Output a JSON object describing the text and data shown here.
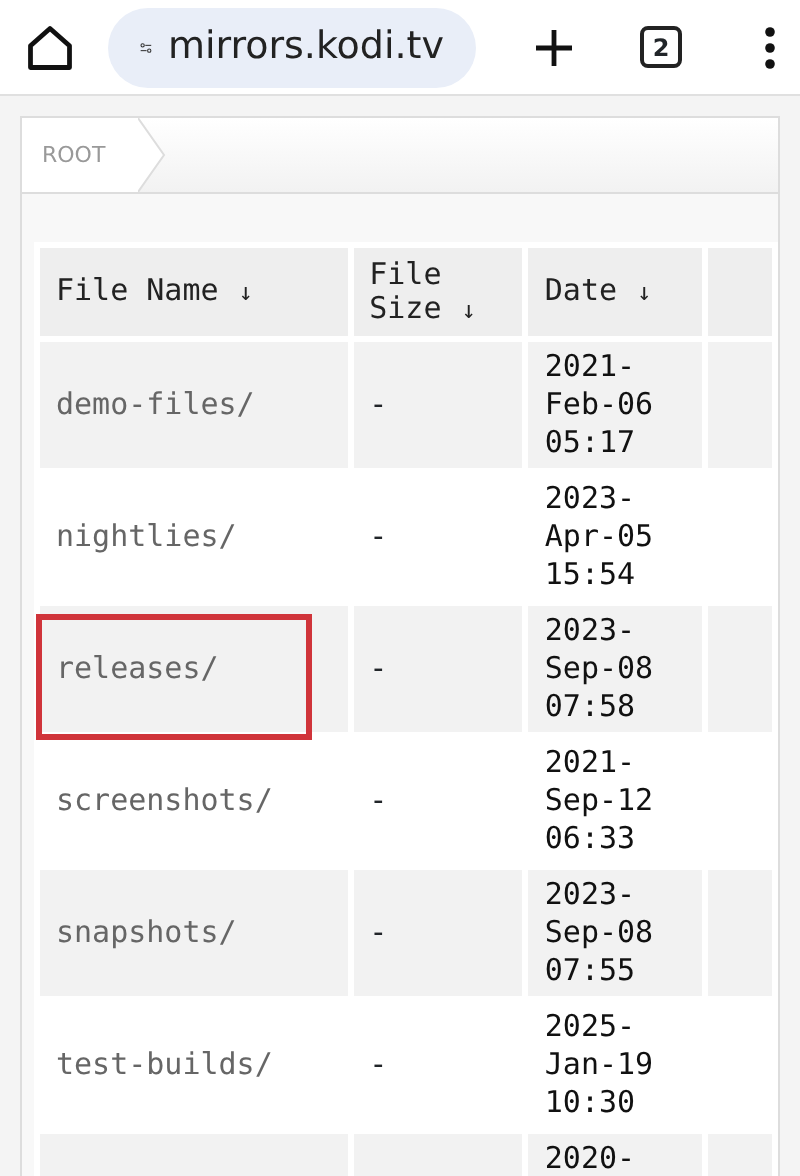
{
  "browser": {
    "url": "mirrors.kodi.tv",
    "tab_count": "2"
  },
  "breadcrumb": [
    {
      "label": "ROOT"
    }
  ],
  "table": {
    "columns": [
      {
        "label": "File Name",
        "sort": "↓"
      },
      {
        "label": "File Size",
        "sort": "↓"
      },
      {
        "label": "Date",
        "sort": "↓"
      }
    ],
    "rows": [
      {
        "name": "demo-files/",
        "size": "-",
        "date": "2021-Feb-06 05:17",
        "highlighted": false
      },
      {
        "name": "nightlies/",
        "size": "-",
        "date": "2023-Apr-05 15:54",
        "highlighted": false
      },
      {
        "name": "releases/",
        "size": "-",
        "date": "2023-Sep-08 07:58",
        "highlighted": true
      },
      {
        "name": "screenshots/",
        "size": "-",
        "date": "2021-Sep-12 06:33",
        "highlighted": false
      },
      {
        "name": "snapshots/",
        "size": "-",
        "date": "2023-Sep-08 07:55",
        "highlighted": false
      },
      {
        "name": "test-builds/",
        "size": "-",
        "date": "2025-Jan-19 10:30",
        "highlighted": false
      },
      {
        "date": "2020-",
        "highlighted": false
      }
    ]
  }
}
